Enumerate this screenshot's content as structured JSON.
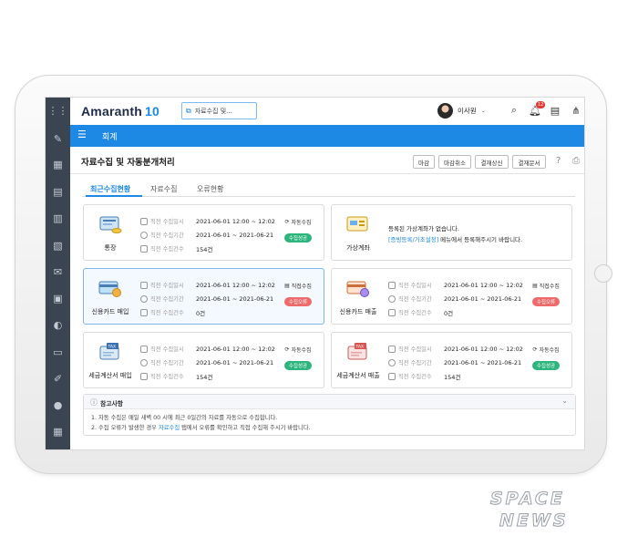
{
  "app": {
    "logo_main": "Amaranth",
    "logo_version": "10"
  },
  "topbar": {
    "shortcut_label": "자료수집 및...",
    "user_name": "이사원",
    "notification_count": "12"
  },
  "module": {
    "title": "회계"
  },
  "page": {
    "title": "자료수집 및 자동분개처리",
    "buttons": [
      "마감",
      "마감취소",
      "결재상신",
      "결재문서"
    ]
  },
  "tabs": [
    "최근수집현황",
    "자료수집",
    "오류현황"
  ],
  "field_labels": {
    "collected_at": "직전 수집일시",
    "period": "직전 수집기간",
    "count": "직전 수집건수"
  },
  "cards": [
    {
      "name": "통장",
      "icon": "bank-book-icon",
      "collected_at": "2021-06-01    12:00 ~ 12:02",
      "period": "2021-06-01 ~ 2021-06-21",
      "count": "154건",
      "mode": "자동수집",
      "status": "수집성공",
      "status_type": "ok"
    },
    {
      "name": "가상계좌",
      "icon": "virtual-account-icon",
      "message_line1": "등록된 가상계좌가 없습니다.",
      "message_link": "[증빙등록/기초설정]",
      "message_line2": " 메뉴에서 등록해주시기 바랍니다."
    },
    {
      "name": "신용카드 매입",
      "icon": "credit-card-icon",
      "collected_at": "2021-06-01    12:00 ~ 12:02",
      "period": "2021-06-01 ~ 2021-06-21",
      "count": "0건",
      "mode": "직접수집",
      "status": "수집오류",
      "status_type": "err"
    },
    {
      "name": "신용카드 매출",
      "icon": "credit-card-icon",
      "collected_at": "2021-06-01    12:00 ~ 12:02",
      "period": "2021-06-01 ~ 2021-06-21",
      "count": "0건",
      "mode": "직접수집",
      "status": "수집오류",
      "status_type": "err"
    },
    {
      "name": "세금계산서 매입",
      "icon": "tax-invoice-icon",
      "collected_at": "2021-06-01    12:00 ~ 12:02",
      "period": "2021-06-01 ~ 2021-06-21",
      "count": "154건",
      "mode": "자동수집",
      "status": "수집성공",
      "status_type": "ok"
    },
    {
      "name": "세금계산서 매출",
      "icon": "tax-invoice-icon",
      "collected_at": "2021-06-01    12:00 ~ 12:02",
      "period": "2021-06-01 ~ 2021-06-21",
      "count": "154건",
      "mode": "자동수집",
      "status": "수집성공",
      "status_type": "ok"
    }
  ],
  "notes": {
    "title": "참고사항",
    "line1": "1. 자동 수집은 매일 새벽 00 시에 최근 0일간의 자료를 자동으로 수집합니다.",
    "line2_a": "2. 수집 오류가 발생한 경우 ",
    "line2_link": "자료수집",
    "line2_b": " 탭에서 오류를 확인하고 직접 수집해 주시기 바랍니다."
  },
  "watermark": {
    "line1": "SPACE",
    "line2": "NEWS"
  },
  "colors": {
    "accent": "#1e88e5",
    "rail": "#3b4451",
    "success": "#2cb67d",
    "error": "#ef6a6a"
  }
}
